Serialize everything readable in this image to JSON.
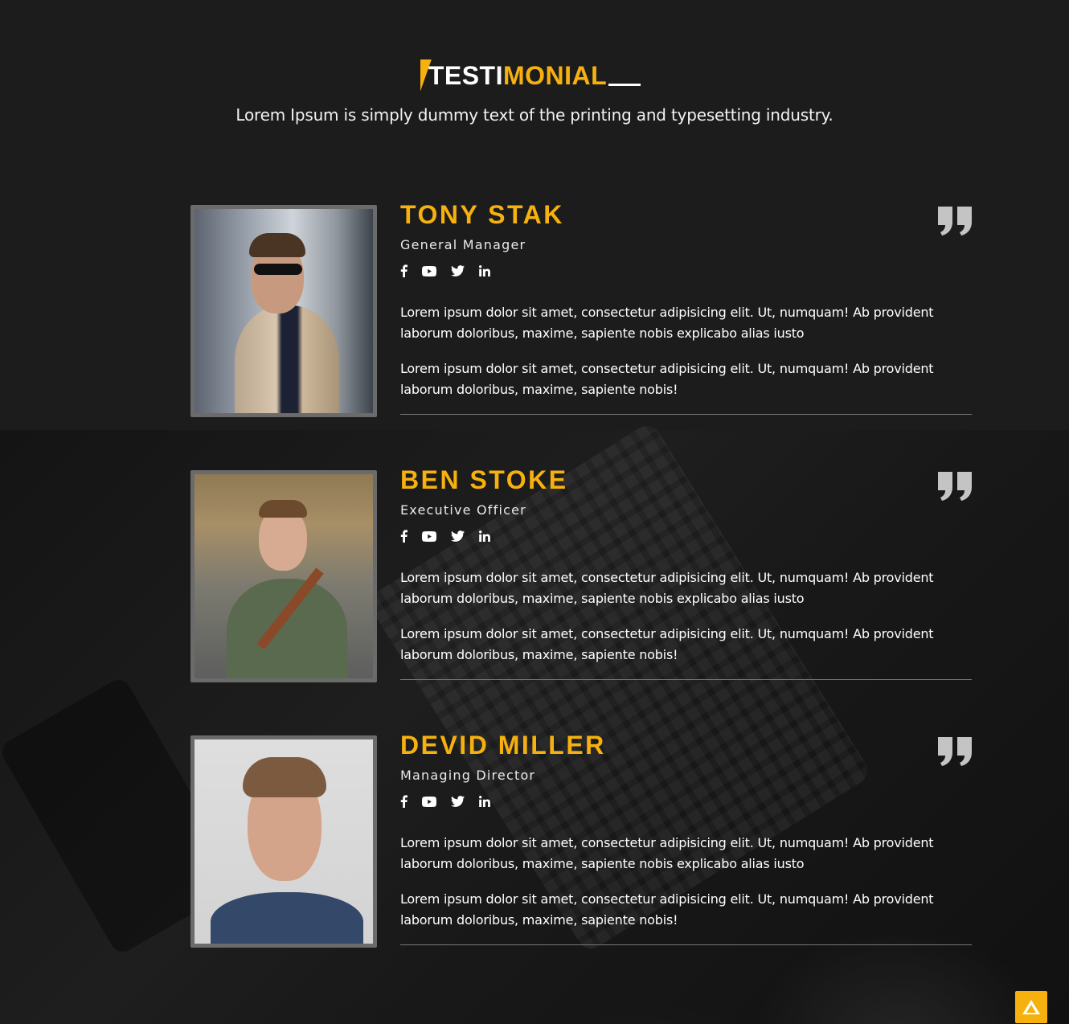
{
  "header": {
    "title_white": "TESTI",
    "title_yellow": "MONIAL",
    "subtitle": "Lorem Ipsum is simply dummy text of the printing and typesetting industry."
  },
  "colors": {
    "accent": "#f6b10f",
    "background": "#1c1c1c",
    "quote": "#c4c4c4"
  },
  "testimonials": [
    {
      "name": "TONY STAK",
      "role": "General Manager",
      "para1": "Lorem ipsum dolor sit amet, consectetur adipisicing elit. Ut, numquam! Ab provident laborum doloribus, maxime, sapiente nobis explicabo alias iusto",
      "para2": "Lorem ipsum dolor sit amet, consectetur adipisicing elit. Ut, numquam! Ab provident laborum doloribus, maxime, sapiente nobis!"
    },
    {
      "name": "BEN STOKE",
      "role": "Executive Officer",
      "para1": "Lorem ipsum dolor sit amet, consectetur adipisicing elit. Ut, numquam! Ab provident laborum doloribus, maxime, sapiente nobis explicabo alias iusto",
      "para2": "Lorem ipsum dolor sit amet, consectetur adipisicing elit. Ut, numquam! Ab provident laborum doloribus, maxime, sapiente nobis!"
    },
    {
      "name": "DEVID MILLER",
      "role": "Managing Director",
      "para1": "Lorem ipsum dolor sit amet, consectetur adipisicing elit. Ut, numquam! Ab provident laborum doloribus, maxime, sapiente nobis explicabo alias iusto",
      "para2": "Lorem ipsum dolor sit amet, consectetur adipisicing elit. Ut, numquam! Ab provident laborum doloribus, maxime, sapiente nobis!"
    }
  ],
  "social_icons": [
    "facebook-icon",
    "youtube-icon",
    "twitter-icon",
    "linkedin-icon"
  ],
  "scroll_top_icon": "arrow-up-icon"
}
